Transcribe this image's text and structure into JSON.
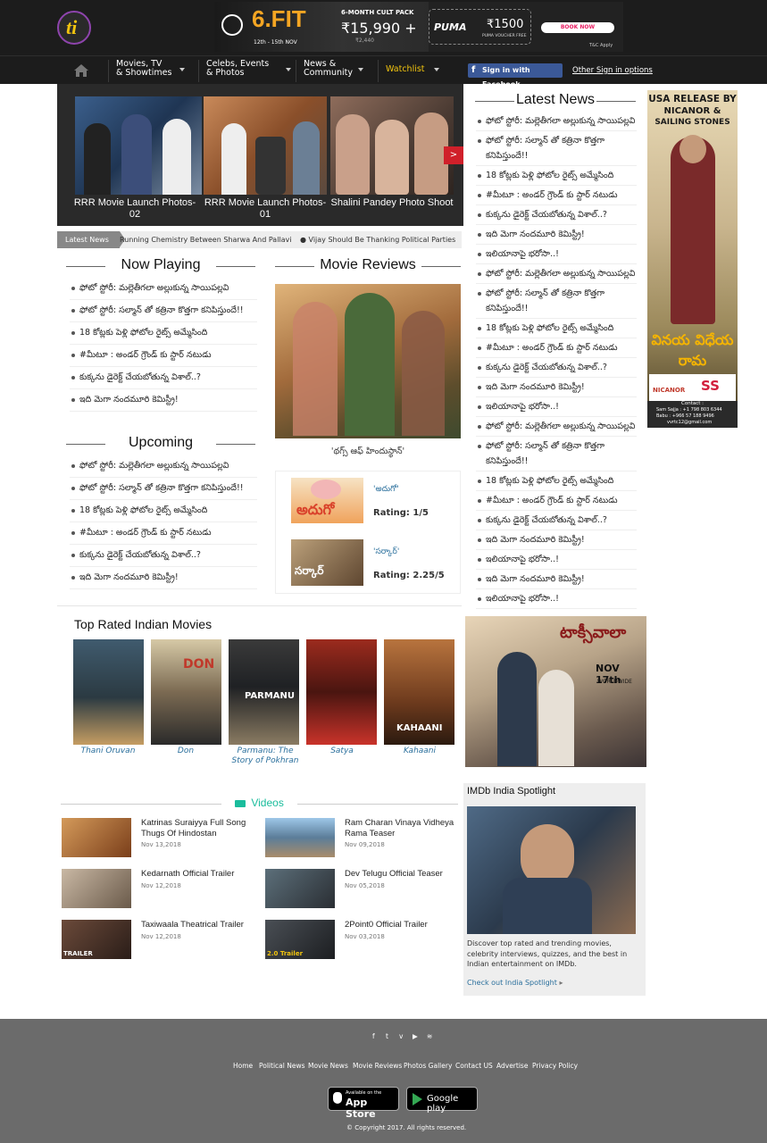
{
  "header": {
    "logo_text": "ti",
    "ad": {
      "brand": "6.FIT",
      "date": "12th - 15th NOV",
      "offer": "6-MONTH CULT PACK",
      "price": "₹15,990 +",
      "strike": "₹2,440",
      "puma": "PUMA",
      "puma_sub": "PUMA VOUCHER FREE",
      "puma_value": "₹1500",
      "cta": "BOOK NOW",
      "tc": "T&C Apply"
    }
  },
  "nav": {
    "items": [
      {
        "label": "Movies, TV\n& Showtimes"
      },
      {
        "label": "Celebs, Events\n& Photos"
      },
      {
        "label": "News &\nCommunity"
      },
      {
        "label": "Watchlist"
      }
    ],
    "fb": "Sign in with Facebook",
    "other": "Other Sign in options"
  },
  "slider": {
    "items": [
      {
        "caption": "RRR Movie Launch Photos-02"
      },
      {
        "caption": "RRR Movie Launch Photos-01"
      },
      {
        "caption": "Shalini Pandey Photo Shoot"
      }
    ],
    "next": ">"
  },
  "ticker": {
    "label": "Latest News",
    "text1": "Running Chemistry Between Sharwa And Pallavi",
    "text2": "Vijay Should Be Thanking Political Parties"
  },
  "now_playing": {
    "title": "Now Playing",
    "items": [
      "ఫోటో స్టోరీ: మల్లెతీగలా అల్లుకున్న సాయిపల్లవి",
      "ఫోటో స్టోరీ: సల్మాన్ తో కత్రినా కొత్తగా కనిపిస్తుందే!!",
      "18 కోట్లకు పెళ్లి ఫోటోల రైట్స్ అమ్మేసింది",
      "#మీటూ : అండర్ గ్రౌండ్ కు స్టార్ నటుడు",
      "కుక్కను డైరెక్ట్ చేయబోతున్న విశాల్..?",
      "ఇది మెగా నందమూరి కెమిస్ట్రీ!"
    ]
  },
  "upcoming": {
    "title": "Upcoming",
    "items": [
      "ఫోటో స్టోరీ: మల్లెతీగలా అల్లుకున్న సాయిపల్లవి",
      "ఫోటో స్టోరీ: సల్మాన్ తో కత్రినా కొత్తగా కనిపిస్తుందే!!",
      "18 కోట్లకు పెళ్లి ఫోటోల రైట్స్ అమ్మేసింది",
      "#మీటూ : అండర్ గ్రౌండ్ కు స్టార్ నటుడు",
      "కుక్కను డైరెక్ట్ చేయబోతున్న విశాల్..?",
      "ఇది మెగా నందమూరి కెమిస్ట్రీ!"
    ]
  },
  "movie_reviews": {
    "title": "Movie Reviews",
    "main_caption": "'థగ్స్ ఆఫ్ హిందుస్థాన్'",
    "reviews": [
      {
        "title": "'అదుగో'",
        "rating": "Rating: 1/5",
        "thumb_text": "అదుగో"
      },
      {
        "title": "'సర్కార్'",
        "rating": "Rating: 2.25/5",
        "thumb_text": "సర్కార్"
      }
    ]
  },
  "latest_news": {
    "title": "Latest News",
    "items": [
      "ఫోటో స్టోరీ: మల్లెతీగలా అల్లుకున్న సాయిపల్లవి",
      "ఫోటో స్టోరీ: సల్మాన్ తో కత్రినా కొత్తగా కనిపిస్తుందే!!",
      "18 కోట్లకు పెళ్లి ఫోటోల రైట్స్ అమ్మేసింది",
      "#మీటూ : అండర్ గ్రౌండ్ కు స్టార్ నటుడు",
      "కుక్కను డైరెక్ట్ చేయబోతున్న విశాల్..?",
      "ఇది మెగా నందమూరి కెమిస్ట్రీ!",
      "ఇలియానాపై భరోసా..!",
      "ఫోటో స్టోరీ: మల్లెతీగలా అల్లుకున్న సాయిపల్లవి",
      "ఫోటో స్టోరీ: సల్మాన్ తో కత్రినా కొత్తగా కనిపిస్తుందే!!",
      "18 కోట్లకు పెళ్లి ఫోటోల రైట్స్ అమ్మేసింది",
      "#మీటూ : అండర్ గ్రౌండ్ కు స్టార్ నటుడు",
      "కుక్కను డైరెక్ట్ చేయబోతున్న విశాల్..?",
      "ఇది మెగా నందమూరి కెమిస్ట్రీ!",
      "ఇలియానాపై భరోసా..!",
      "ఫోటో స్టోరీ: మల్లెతీగలా అల్లుకున్న సాయిపల్లవి",
      "ఫోటో స్టోరీ: సల్మాన్ తో కత్రినా కొత్తగా కనిపిస్తుందే!!",
      "18 కోట్లకు పెళ్లి ఫోటోల రైట్స్ అమ్మేసింది",
      "#మీటూ : అండర్ గ్రౌండ్ కు స్టార్ నటుడు",
      "కుక్కను డైరెక్ట్ చేయబోతున్న విశాల్..?",
      "ఇది మెగా నందమూరి కెమిస్ట్రీ!",
      "ఇలియానాపై భరోసా..!",
      "ఇది మెగా నందమూరి కెమిస్ట్రీ!",
      "ఇలియానాపై భరోసా..!"
    ]
  },
  "side_ad": {
    "line1": "USA RELEASE BY",
    "line2": "NICANOR &",
    "line3": "SAILING STONES",
    "movie": "వినయ విధేయ రామ",
    "brand": "NICANOR",
    "brand2": "SS",
    "contact": "Contact :",
    "phone1": "Sam Sajja : +1 798 803 6344",
    "phone2": "Babu : +966 57 188 9496",
    "email": "vvrtc12@gmail.com"
  },
  "top_rated": {
    "title": "Top Rated Indian Movies",
    "movies": [
      {
        "name": "Thani Oruvan"
      },
      {
        "name": "Don"
      },
      {
        "name": "Parmanu: The Story of Pokhran"
      },
      {
        "name": "Satya"
      },
      {
        "name": "Kahaani"
      }
    ]
  },
  "taxiwaala_ad": {
    "title": "టాక్సీవాలా",
    "date": "NOV 17th",
    "sub": "WORLDWIDE"
  },
  "videos": {
    "title": "Videos",
    "items": [
      {
        "title": "Katrinas Suraiyya Full Song Thugs Of Hindostan",
        "date": "Nov 13,2018"
      },
      {
        "title": "Ram Charan Vinaya Vidheya Rama Teaser",
        "date": "Nov 09,2018"
      },
      {
        "title": "Kedarnath Official Trailer",
        "date": "Nov 12,2018"
      },
      {
        "title": "Dev Telugu Official Teaser",
        "date": "Nov 05,2018"
      },
      {
        "title": "Taxiwaala Theatrical Trailer",
        "date": "Nov 12,2018",
        "badge": "TRAILER"
      },
      {
        "title": "2Point0 Official Trailer",
        "date": "Nov 03,2018",
        "badge": "2.0 Trailer"
      }
    ]
  },
  "imdb": {
    "title": "IMDb India Spotlight",
    "desc": "Discover top rated and trending movies, celebrity interviews, quizzes, and the best in Indian entertainment on IMDb.",
    "link": "Check out India Spotlight",
    "link_arrow": "▸"
  },
  "footer": {
    "links": [
      "Home",
      "Political News",
      "Movie News",
      "Movie Reviews",
      "Photos Gallery",
      "Contact US",
      "Advertise",
      "Privacy Policy"
    ],
    "appstore_small": "Available on the",
    "appstore": "App Store",
    "google": "Google play",
    "copyright": "© Copyright 2017. All rights reserved.",
    "social": [
      "f",
      "t",
      "v",
      "▶",
      "≋"
    ]
  },
  "colors": {
    "header_bg": "#1c1c1c",
    "accent_yellow": "#f1c40f",
    "red_arrow": "#d0202a",
    "fb_blue": "#3b5998",
    "caption_link": "#2a6f9c",
    "video_accent": "#1abc9c",
    "footer_bg": "#6b6b6b"
  }
}
